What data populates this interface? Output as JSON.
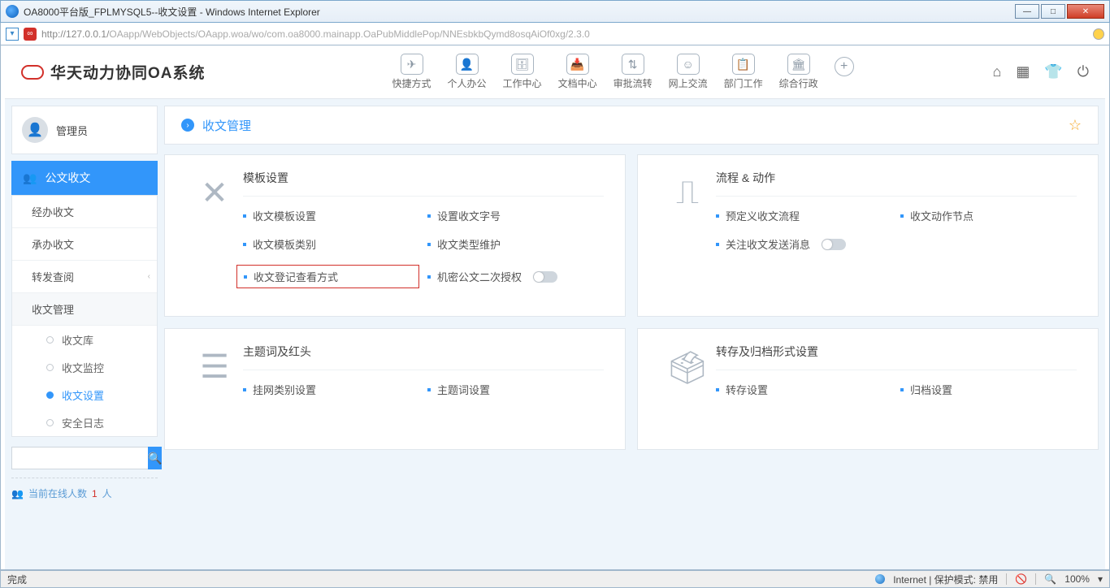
{
  "window": {
    "title": "OA8000平台版_FPLMYSQL5--收文设置 - Windows Internet Explorer"
  },
  "url": {
    "host": "http://127.0.0.1/",
    "path": "OAapp/WebObjects/OAapp.woa/wo/com.oa8000.mainapp.OaPubMiddlePop/NNEsbkbQymd8osqAiOf0xg/2.3.0"
  },
  "logo": {
    "text": "华天动力协同OA系统"
  },
  "nav": {
    "items": [
      {
        "label": "快捷方式"
      },
      {
        "label": "个人办公"
      },
      {
        "label": "工作中心"
      },
      {
        "label": "文档中心"
      },
      {
        "label": "审批流转"
      },
      {
        "label": "网上交流"
      },
      {
        "label": "部门工作"
      },
      {
        "label": "综合行政"
      }
    ]
  },
  "user": {
    "name": "管理员"
  },
  "sidebar": {
    "header": "公文收文",
    "items": [
      {
        "label": "经办收文"
      },
      {
        "label": "承办收文"
      },
      {
        "label": "转发查阅"
      },
      {
        "label": "收文管理"
      }
    ],
    "subitems": [
      {
        "label": "收文库"
      },
      {
        "label": "收文监控"
      },
      {
        "label": "收文设置"
      },
      {
        "label": "安全日志"
      }
    ],
    "search_placeholder": "",
    "online_label": "当前在线人数",
    "online_count": "1",
    "online_unit": "人"
  },
  "crumb": {
    "title": "收文管理"
  },
  "cards": {
    "c1": {
      "title": "模板设置",
      "links": [
        "收文模板设置",
        "设置收文字号",
        "收文模板类别",
        "收文类型维护",
        "收文登记查看方式",
        "机密公文二次授权"
      ]
    },
    "c2": {
      "title": "流程 & 动作",
      "links": [
        "预定义收文流程",
        "收文动作节点",
        "关注收文发送消息"
      ]
    },
    "c3": {
      "title": "主题词及红头",
      "links": [
        "挂网类别设置",
        "主题词设置"
      ]
    },
    "c4": {
      "title": "转存及归档形式设置",
      "links": [
        "转存设置",
        "归档设置"
      ]
    }
  },
  "status": {
    "left": "完成",
    "right": "Internet | 保护模式: 禁用",
    "zoom": "100%"
  }
}
